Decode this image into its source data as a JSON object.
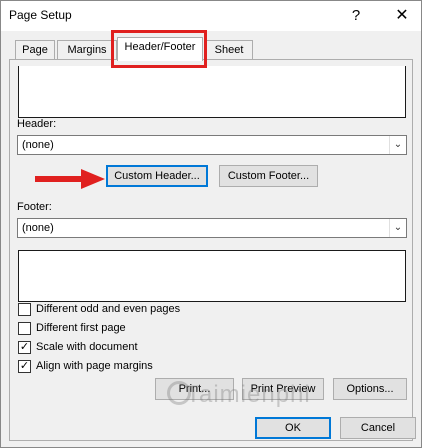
{
  "window": {
    "title": "Page Setup",
    "help_glyph": "?",
    "close_glyph": "✕"
  },
  "tabs": [
    {
      "label": "Page"
    },
    {
      "label": "Margins"
    },
    {
      "label": "Header/Footer"
    },
    {
      "label": "Sheet"
    }
  ],
  "header": {
    "label": "Header:",
    "value": "(none)",
    "custom_button": "Custom Header..."
  },
  "footer": {
    "label": "Footer:",
    "value": "(none)",
    "custom_button": "Custom Footer..."
  },
  "options": [
    {
      "label": "Different odd and even pages",
      "checked": false
    },
    {
      "label": "Different first page",
      "checked": false
    },
    {
      "label": "Scale with document",
      "checked": true
    },
    {
      "label": "Align with page margins",
      "checked": true
    }
  ],
  "buttons": {
    "print": "Print...",
    "print_preview": "Print Preview",
    "options": "Options...",
    "ok": "OK",
    "cancel": "Cancel"
  },
  "watermark": {
    "text": "Taimienphi"
  },
  "colors": {
    "highlight": "#e0201f",
    "focus": "#0078d7"
  }
}
